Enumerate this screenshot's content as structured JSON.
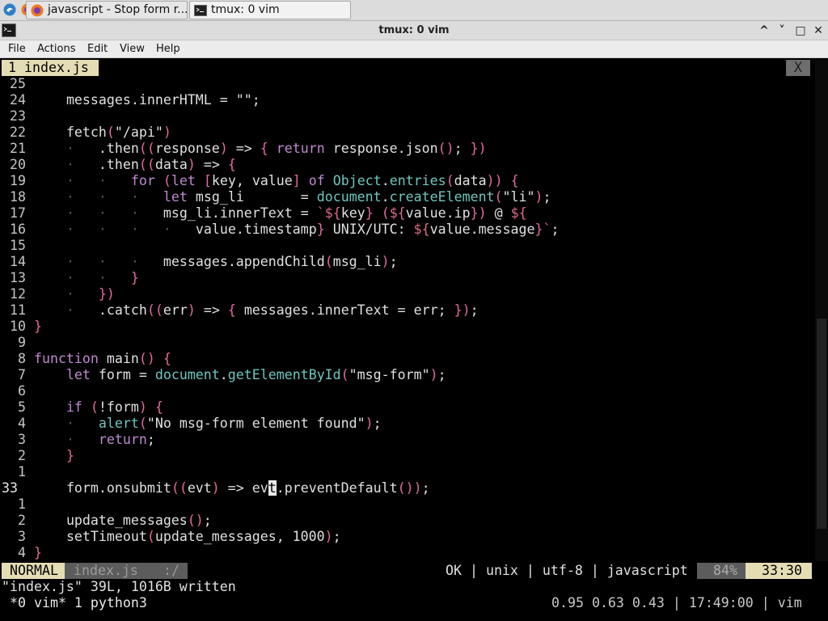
{
  "taskbar": {
    "tasks": [
      {
        "label": "javascript - Stop form r..."
      },
      {
        "label": "tmux: 0 vim"
      }
    ]
  },
  "window": {
    "title": "tmux: 0 vim",
    "controls": {
      "minimize": "^",
      "maximize": "˅",
      "restore": "□",
      "close": "✕"
    }
  },
  "menubar": [
    "File",
    "Actions",
    "Edit",
    "View",
    "Help"
  ],
  "vim": {
    "tab_label": "1 index.js",
    "close_label": "X",
    "lines": [
      {
        "num": "25",
        "indent": 0,
        "text": ""
      },
      {
        "num": "24",
        "indent": 1,
        "text": "messages.innerHTML = \"\";"
      },
      {
        "num": "23",
        "indent": 0,
        "text": ""
      },
      {
        "num": "22",
        "indent": 1,
        "text": "fetch(\"/api\")"
      },
      {
        "num": "21",
        "indent": 2,
        "text": ".then((response) => { return response.json(); })"
      },
      {
        "num": "20",
        "indent": 2,
        "text": ".then((data) => {"
      },
      {
        "num": "19",
        "indent": 3,
        "text": "for (let [key, value] of Object.entries(data)) {"
      },
      {
        "num": "18",
        "indent": 4,
        "text": "let msg_li       = document.createElement(\"li\");"
      },
      {
        "num": "17",
        "indent": 4,
        "text": "msg_li.innerText = `${key} (${value.ip}) @ ${"
      },
      {
        "num": "16",
        "indent": 5,
        "text": "value.timestamp} UNIX/UTC: ${value.message}`;"
      },
      {
        "num": "15",
        "indent": 0,
        "text": ""
      },
      {
        "num": "14",
        "indent": 4,
        "text": "messages.appendChild(msg_li);"
      },
      {
        "num": "13",
        "indent": 3,
        "text": "}"
      },
      {
        "num": "12",
        "indent": 2,
        "text": "})"
      },
      {
        "num": "11",
        "indent": 2,
        "text": ".catch((err) => { messages.innerText = err; });"
      },
      {
        "num": "10",
        "indent": 0,
        "text": "}"
      },
      {
        "num": "9",
        "indent": 0,
        "text": ""
      },
      {
        "num": "8",
        "indent": 0,
        "text": "function main() {"
      },
      {
        "num": "7",
        "indent": 1,
        "text": "let form = document.getElementById(\"msg-form\");"
      },
      {
        "num": "6",
        "indent": 0,
        "text": ""
      },
      {
        "num": "5",
        "indent": 1,
        "text": "if (!form) {"
      },
      {
        "num": "4",
        "indent": 2,
        "text": "alert(\"No msg-form element found\");"
      },
      {
        "num": "3",
        "indent": 2,
        "text": "return;"
      },
      {
        "num": "2",
        "indent": 1,
        "text": "}"
      },
      {
        "num": "1",
        "indent": 0,
        "text": ""
      },
      {
        "num": "33",
        "indent": 1,
        "text": "form.onsubmit((evt) => evt.preventDefault());",
        "current": true
      },
      {
        "num": "1",
        "indent": 0,
        "text": ""
      },
      {
        "num": "2",
        "indent": 1,
        "text": "update_messages();"
      },
      {
        "num": "3",
        "indent": 1,
        "text": "setTimeout(update_messages, 1000);"
      },
      {
        "num": "4",
        "indent": 0,
        "text": "}"
      }
    ],
    "statusline": {
      "mode": "NORMAL",
      "file": "index.js",
      "sep": ":/",
      "info": "OK | unix | utf-8 | javascript",
      "percent": "84%",
      "position": "33:30"
    },
    "message": "\"index.js\" 39L, 1016B written"
  },
  "tmux": {
    "left": "*0 vim* 1 python3",
    "right": "0.95 0.63 0.43 | 17:49:00 | vim"
  },
  "colors": {
    "keyword": "#c089d0",
    "function": "#6cc6c0",
    "bracket": "#e56aa0",
    "template": "#e06a88",
    "mode_bg": "#e4ddb3",
    "position_bg": "#e4ddb3"
  }
}
